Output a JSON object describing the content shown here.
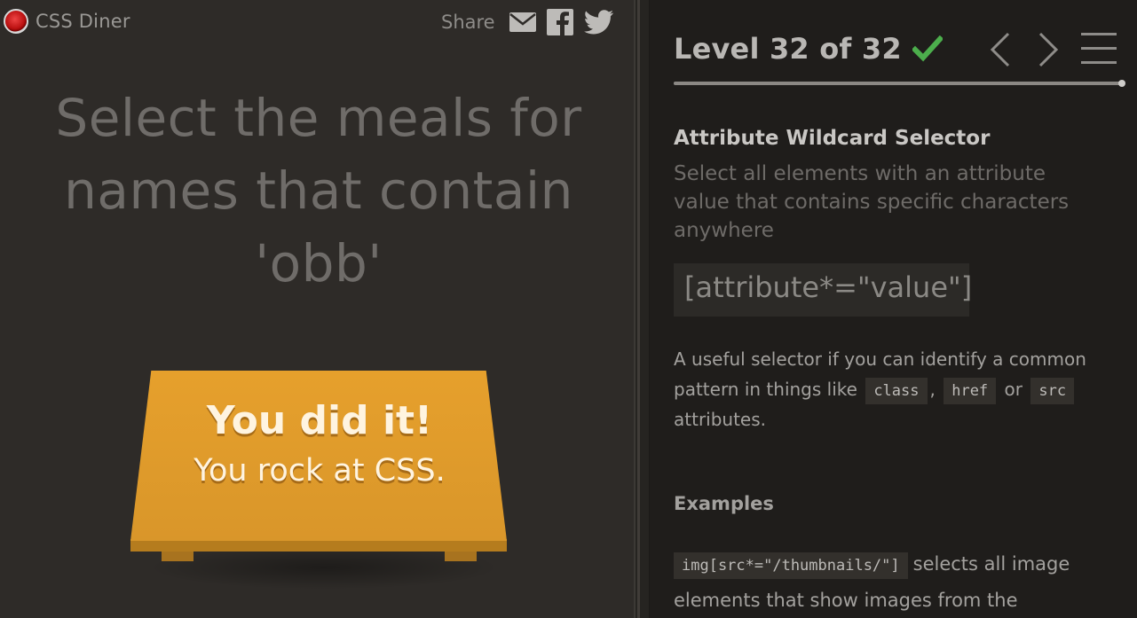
{
  "header": {
    "app_name": "CSS Diner",
    "share_label": "Share",
    "share_icons": [
      "email-icon",
      "facebook-icon",
      "twitter-icon"
    ]
  },
  "instruction": "Select the meals for names that contain 'obb'",
  "win_message": {
    "title": "You did it!",
    "subtitle": "You rock at CSS."
  },
  "level": {
    "title": "Level 32 of 32",
    "completed": true,
    "check_color": "#4cae4c",
    "progress_fraction": 1.0
  },
  "selector": {
    "name": "Attribute Wildcard Selector",
    "description": "Select all elements with an attribute value that contains specific characters anywhere",
    "syntax": "[attribute*=\"value\"]"
  },
  "hint": {
    "part1": "A useful selector if you can identify a common pattern in things like",
    "code1": "class",
    "sep1": ",",
    "code2": "href",
    "sep2": "or",
    "code3": "src",
    "part2": "attributes."
  },
  "examples": {
    "title": "Examples",
    "items": [
      {
        "code": "img[src*=\"/thumbnails/\"]",
        "text": "selects all image elements that show images from the"
      }
    ]
  },
  "colors": {
    "left_bg": "#2e2b28",
    "right_bg": "#1f1d1b",
    "table": "#e09c2b"
  }
}
